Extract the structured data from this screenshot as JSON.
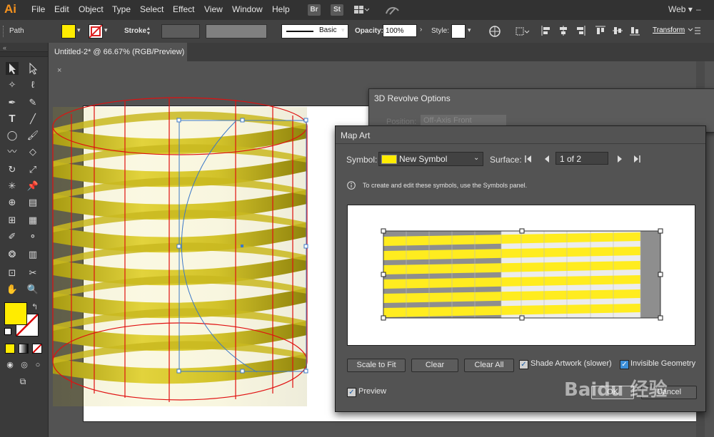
{
  "app": {
    "logo": "Ai",
    "workspace": "Web"
  },
  "menu": [
    "File",
    "Edit",
    "Object",
    "Type",
    "Select",
    "Effect",
    "View",
    "Window",
    "Help"
  ],
  "menu_buttons": {
    "bridge": "Br",
    "stock": "St"
  },
  "control_bar": {
    "object_label": "Path",
    "stroke_label": "Stroke:",
    "brush_label": "Basic",
    "opacity_label": "Opacity:",
    "opacity_value": "100%",
    "style_label": "Style:",
    "transform_label": "Transform",
    "fill_color": "#ffec00"
  },
  "document": {
    "tab_title": "Untitled-2* @ 66.67% (RGB/Preview)"
  },
  "dialog_revolve": {
    "title": "3D Revolve Options",
    "position_label": "Position:",
    "position_value": "Off-Axis Front"
  },
  "dialog_mapart": {
    "title": "Map Art",
    "symbol_label": "Symbol:",
    "symbol_value": "New Symbol",
    "surface_label": "Surface:",
    "surface_value": "1 of 2",
    "info_text": "To create and edit these symbols, use the Symbols panel.",
    "buttons": {
      "scale_to_fit": "Scale to Fit",
      "clear": "Clear",
      "clear_all": "Clear All",
      "ok": "OK",
      "cancel": "Cancel"
    },
    "shade_artwork_label": "Shade Artwork (slower)",
    "shade_artwork_checked": true,
    "invisible_geometry_label": "Invisible Geometry",
    "invisible_geometry_checked": true,
    "preview_label": "Preview",
    "preview_checked": true
  },
  "colors": {
    "fill_swatch": "#ffec00",
    "band_yellow": "#d6c72b",
    "wire_red": "#e01010",
    "selection_blue": "#3b78c8"
  },
  "watermark": "Baidu 经验"
}
